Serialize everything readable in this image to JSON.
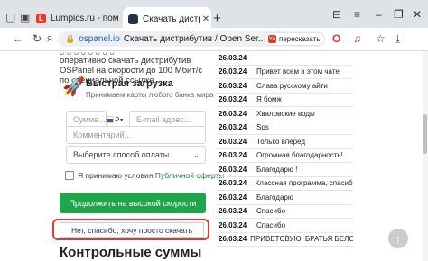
{
  "tabs": [
    {
      "title": "Lumpics.ru - помощь с ко",
      "favicon": "L",
      "active": false
    },
    {
      "title": "Скачать дистрибутив",
      "active": true
    }
  ],
  "address_bar": {
    "domain": "ospanel.io",
    "title": "Скачать дистрибутив / Open Ser...",
    "retell_label": "пересказать",
    "retell_badge": "YA"
  },
  "page": {
    "intro_text": "оперативно скачать дистрибутив OSPanel на скорости до 100 Мбит/с по специальной ссылке.",
    "fast_download": {
      "title": "Быстрая загрузка",
      "subtitle": "Принимаем карты любого банка мира"
    },
    "amount_placeholder": "Сумма...",
    "currency": "₽",
    "email_placeholder": "E-mail адрес...",
    "comment_placeholder": "Комментарий...",
    "payment_select": "Выберите способ оплаты",
    "terms_prefix": "Я принимаю условия",
    "terms_link": "Публичной оферты",
    "fast_button": "Продолжить на высокой скорости",
    "slow_button": "Нет, спасибо, хочу просто скачать",
    "section_heading": "Контрольные суммы"
  },
  "comments": [
    {
      "date": "26.03.24",
      "text": ""
    },
    {
      "date": "26.03.24",
      "text": "Привет всем в этом чате"
    },
    {
      "date": "26.03.24",
      "text": "Слава русскому айти"
    },
    {
      "date": "26.03.24",
      "text": "Я бомж"
    },
    {
      "date": "26.03.24",
      "text": "Хваловские воды"
    },
    {
      "date": "26.03.24",
      "text": "Sps"
    },
    {
      "date": "26.03.24",
      "text": "Только вперед"
    },
    {
      "date": "26.03.24",
      "text": "Огромная благодарность!"
    },
    {
      "date": "26.03.24",
      "text": "Благодарю !"
    },
    {
      "date": "26.03.24",
      "text": "Классная программа, спасибо"
    },
    {
      "date": "26.03.24",
      "text": "Благодарю"
    },
    {
      "date": "26.03.24",
      "text": "Спасибо"
    },
    {
      "date": "26.03.24",
      "text": "Спасибо"
    },
    {
      "date": "26.03.24",
      "text": "ПРИВЕТСВУЮ, БРАТЬЯ БЕЛОРУСЫ!"
    }
  ],
  "colors": {
    "accent_green": "#1fa64a",
    "highlight_red": "#e03a34"
  }
}
